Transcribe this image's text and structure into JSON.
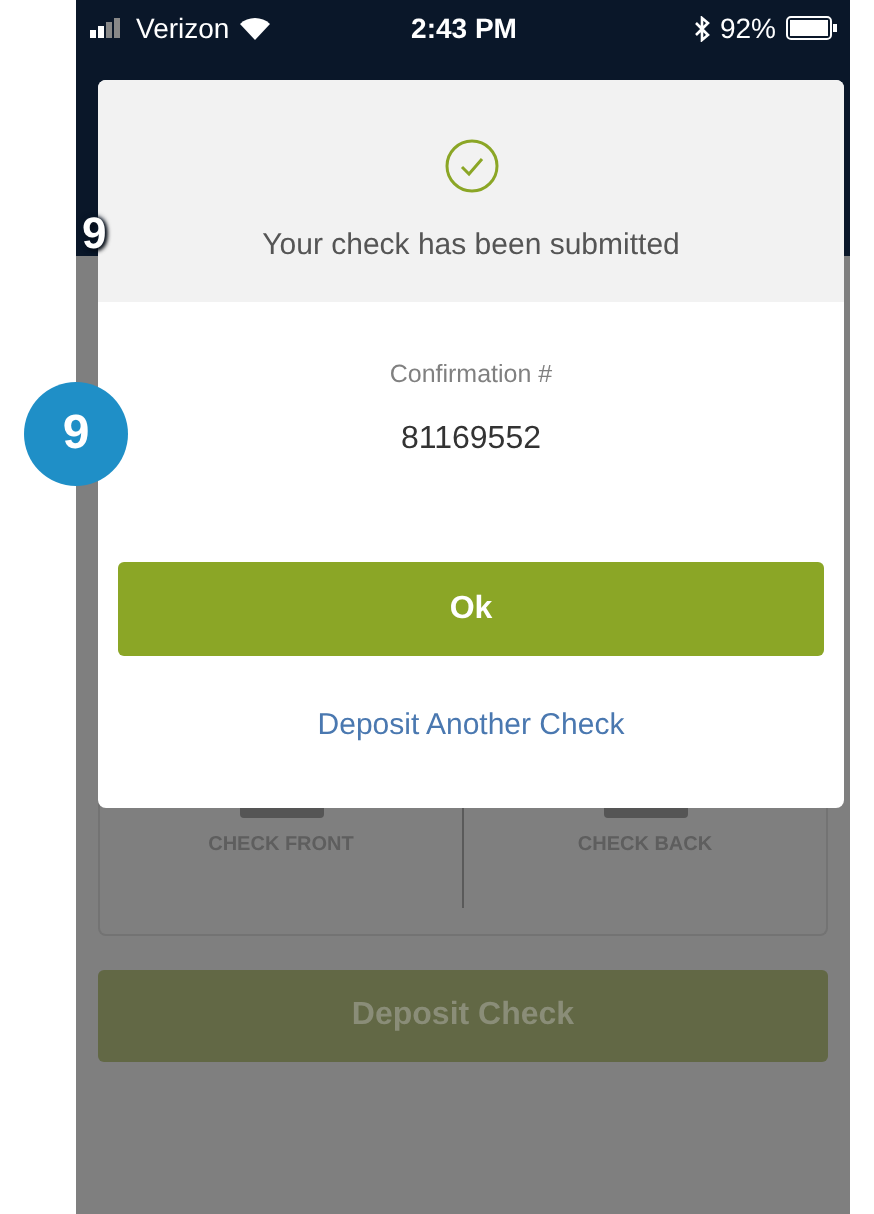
{
  "status_bar": {
    "carrier": "Verizon",
    "time": "2:43 PM",
    "battery": "92%"
  },
  "background": {
    "step_label": "9",
    "capture_labels": [
      "CHECK FRONT",
      "CHECK BACK"
    ],
    "deposit_button": "Deposit Check"
  },
  "dialog": {
    "message": "Your check has been submitted",
    "confirmation_label": "Confirmation #",
    "confirmation_number": "81169552",
    "ok_button": "Ok",
    "link": "Deposit Another Check"
  },
  "step_badge": "9"
}
